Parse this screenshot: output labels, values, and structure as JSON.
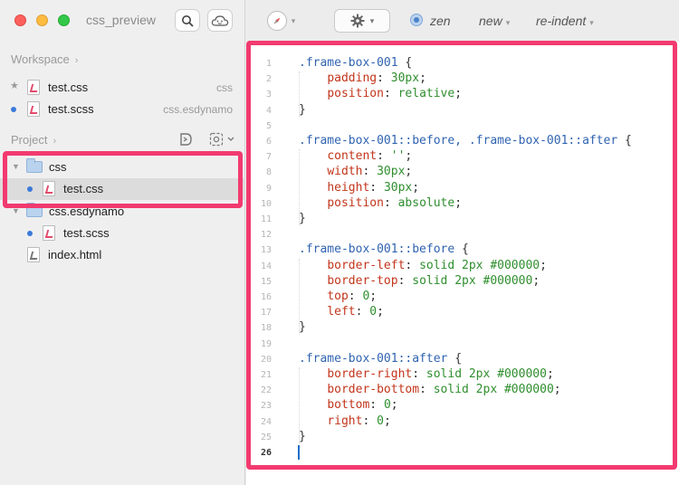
{
  "app": {
    "title": "css_preview"
  },
  "sidebar": {
    "workspace_label": "Workspace",
    "project_label": "Project",
    "workspace_items": [
      {
        "name": "test.css",
        "hint": "css"
      },
      {
        "name": "test.scss",
        "hint": "css.esdynamo"
      }
    ],
    "tree": [
      {
        "name": "css"
      },
      {
        "name": "test.css"
      },
      {
        "name": "css.esdynamo"
      },
      {
        "name": "test.scss"
      },
      {
        "name": "index.html"
      }
    ]
  },
  "toolbar": {
    "zen_label": "zen",
    "new_label": "new",
    "reindent_label": "re-indent"
  },
  "editor": {
    "line_numbers": [
      "1",
      "2",
      "3",
      "4",
      "5",
      "6",
      "7",
      "8",
      "9",
      "10",
      "11",
      "12",
      "13",
      "14",
      "15",
      "16",
      "17",
      "18",
      "19",
      "20",
      "21",
      "22",
      "23",
      "24",
      "25",
      "26"
    ],
    "current_line": 26,
    "lines": [
      [
        {
          "t": "sel",
          "v": ".frame-box-001"
        },
        {
          "t": "punc",
          "v": " {"
        }
      ],
      [
        {
          "t": "punc",
          "v": "    "
        },
        {
          "t": "prop",
          "v": "padding"
        },
        {
          "t": "punc",
          "v": ": "
        },
        {
          "t": "val",
          "v": "30px"
        },
        {
          "t": "punc",
          "v": ";"
        }
      ],
      [
        {
          "t": "punc",
          "v": "    "
        },
        {
          "t": "prop",
          "v": "position"
        },
        {
          "t": "punc",
          "v": ": "
        },
        {
          "t": "val",
          "v": "relative"
        },
        {
          "t": "punc",
          "v": ";"
        }
      ],
      [
        {
          "t": "punc",
          "v": "}"
        }
      ],
      [],
      [
        {
          "t": "sel",
          "v": ".frame-box-001::before, .frame-box-001::after"
        },
        {
          "t": "punc",
          "v": " {"
        }
      ],
      [
        {
          "t": "punc",
          "v": "    "
        },
        {
          "t": "prop",
          "v": "content"
        },
        {
          "t": "punc",
          "v": ": "
        },
        {
          "t": "val",
          "v": "''"
        },
        {
          "t": "punc",
          "v": ";"
        }
      ],
      [
        {
          "t": "punc",
          "v": "    "
        },
        {
          "t": "prop",
          "v": "width"
        },
        {
          "t": "punc",
          "v": ": "
        },
        {
          "t": "val",
          "v": "30px"
        },
        {
          "t": "punc",
          "v": ";"
        }
      ],
      [
        {
          "t": "punc",
          "v": "    "
        },
        {
          "t": "prop",
          "v": "height"
        },
        {
          "t": "punc",
          "v": ": "
        },
        {
          "t": "val",
          "v": "30px"
        },
        {
          "t": "punc",
          "v": ";"
        }
      ],
      [
        {
          "t": "punc",
          "v": "    "
        },
        {
          "t": "prop",
          "v": "position"
        },
        {
          "t": "punc",
          "v": ": "
        },
        {
          "t": "val",
          "v": "absolute"
        },
        {
          "t": "punc",
          "v": ";"
        }
      ],
      [
        {
          "t": "punc",
          "v": "}"
        }
      ],
      [],
      [
        {
          "t": "sel",
          "v": ".frame-box-001::before"
        },
        {
          "t": "punc",
          "v": " {"
        }
      ],
      [
        {
          "t": "punc",
          "v": "    "
        },
        {
          "t": "prop",
          "v": "border-left"
        },
        {
          "t": "punc",
          "v": ": "
        },
        {
          "t": "val",
          "v": "solid 2px #000000"
        },
        {
          "t": "punc",
          "v": ";"
        }
      ],
      [
        {
          "t": "punc",
          "v": "    "
        },
        {
          "t": "prop",
          "v": "border-top"
        },
        {
          "t": "punc",
          "v": ": "
        },
        {
          "t": "val",
          "v": "solid 2px #000000"
        },
        {
          "t": "punc",
          "v": ";"
        }
      ],
      [
        {
          "t": "punc",
          "v": "    "
        },
        {
          "t": "prop",
          "v": "top"
        },
        {
          "t": "punc",
          "v": ": "
        },
        {
          "t": "val",
          "v": "0"
        },
        {
          "t": "punc",
          "v": ";"
        }
      ],
      [
        {
          "t": "punc",
          "v": "    "
        },
        {
          "t": "prop",
          "v": "left"
        },
        {
          "t": "punc",
          "v": ": "
        },
        {
          "t": "val",
          "v": "0"
        },
        {
          "t": "punc",
          "v": ";"
        }
      ],
      [
        {
          "t": "punc",
          "v": "}"
        }
      ],
      [],
      [
        {
          "t": "sel",
          "v": ".frame-box-001::after"
        },
        {
          "t": "punc",
          "v": " {"
        }
      ],
      [
        {
          "t": "punc",
          "v": "    "
        },
        {
          "t": "prop",
          "v": "border-right"
        },
        {
          "t": "punc",
          "v": ": "
        },
        {
          "t": "val",
          "v": "solid 2px #000000"
        },
        {
          "t": "punc",
          "v": ";"
        }
      ],
      [
        {
          "t": "punc",
          "v": "    "
        },
        {
          "t": "prop",
          "v": "border-bottom"
        },
        {
          "t": "punc",
          "v": ": "
        },
        {
          "t": "val",
          "v": "solid 2px #000000"
        },
        {
          "t": "punc",
          "v": ";"
        }
      ],
      [
        {
          "t": "punc",
          "v": "    "
        },
        {
          "t": "prop",
          "v": "bottom"
        },
        {
          "t": "punc",
          "v": ": "
        },
        {
          "t": "val",
          "v": "0"
        },
        {
          "t": "punc",
          "v": ";"
        }
      ],
      [
        {
          "t": "punc",
          "v": "    "
        },
        {
          "t": "prop",
          "v": "right"
        },
        {
          "t": "punc",
          "v": ": "
        },
        {
          "t": "val",
          "v": "0"
        },
        {
          "t": "punc",
          "v": ";"
        }
      ],
      [
        {
          "t": "punc",
          "v": "}"
        }
      ],
      []
    ]
  },
  "colors": {
    "annotation": "#f23a6f",
    "selector": "#2f63b1",
    "property": "#c2351b",
    "value": "#2f8e2e",
    "cursor": "#1f6ec9"
  },
  "icons": [
    "compass-icon",
    "gear-icon",
    "search-icon",
    "cloud-icon",
    "folder-icon",
    "file-icon",
    "dynamo-icon",
    "settings-icon"
  ]
}
